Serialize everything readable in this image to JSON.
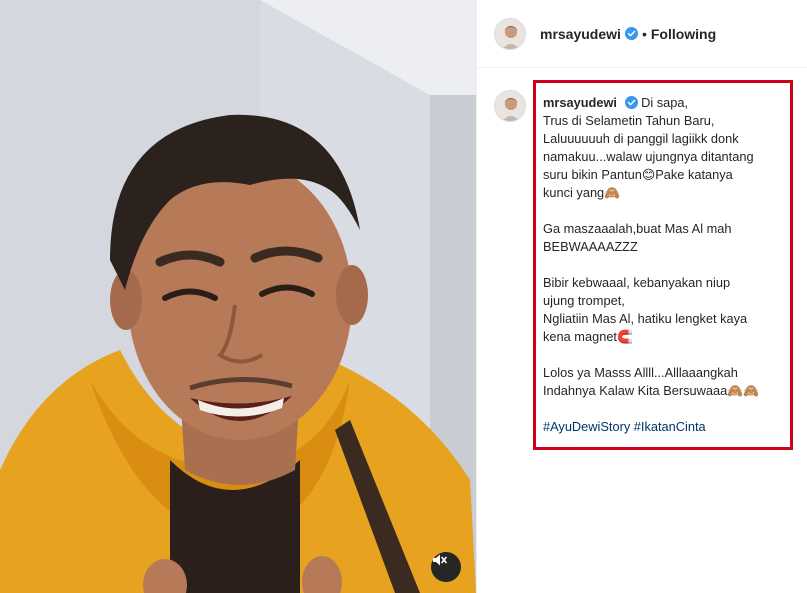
{
  "post": {
    "username": "mrsayudewi",
    "separator": "•",
    "follow_status": "Following"
  },
  "caption": {
    "username": "mrsayudewi",
    "lines": [
      "Di sapa,",
      "Trus di Selametin Tahun Baru,",
      "Laluuuuuuh di panggil lagiikk donk",
      "namakuu...walaw ujungnya ditantang",
      "suru bikin Pantun😊Pake katanya",
      "kunci yang🙈",
      "",
      "Ga maszaaalah,buat Mas Al mah",
      "BEBWAAAAZZZ",
      "",
      "Bibir kebwaaal, kebanyakan niup",
      "ujung trompet,",
      "Ngliatiin Mas Al, hatiku lengket kaya",
      "kena magnet🧲",
      "",
      "Lolos ya Masss Allll...Alllaaangkah",
      "Indahnya Kalaw Kita Bersuwaaa🙈🙈",
      "",
      "#AyuDewiStory #IkatanCinta"
    ]
  },
  "icons": {
    "verified": "verified-badge-icon",
    "mute": "speaker-muted-icon"
  },
  "colors": {
    "highlight_border": "#d0021b",
    "verified": "#3897f0",
    "hashtag": "#00376b",
    "hoodie": "#e9a11e"
  }
}
